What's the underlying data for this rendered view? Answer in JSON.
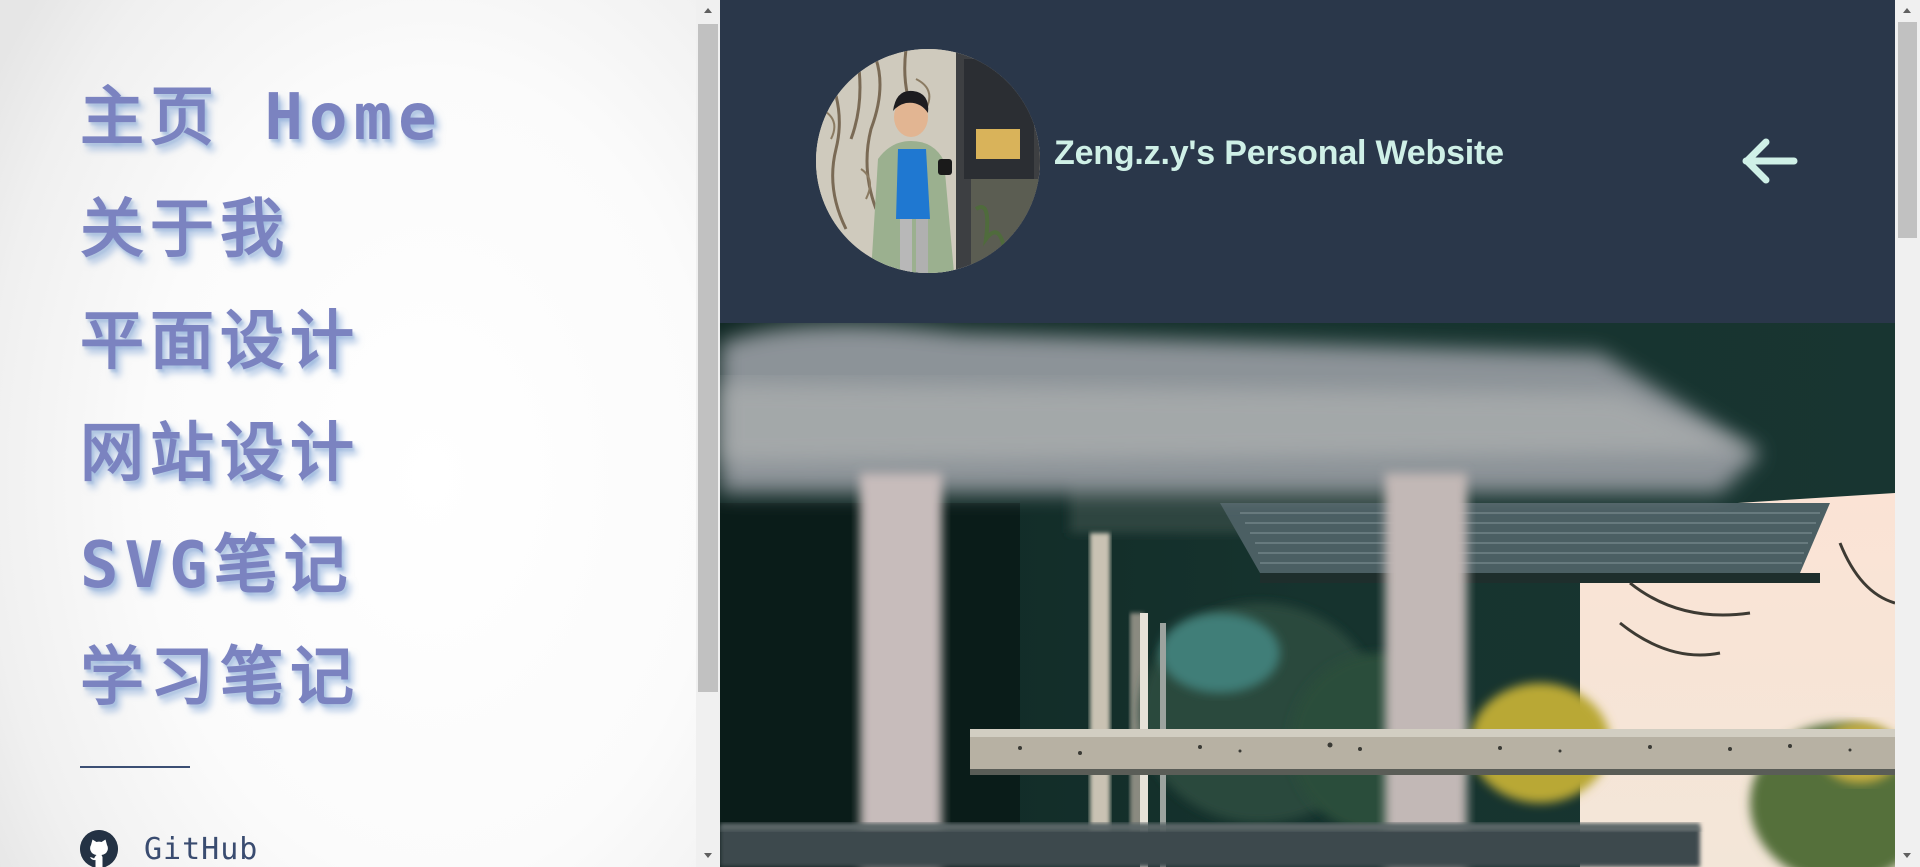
{
  "nav": {
    "items": [
      {
        "label": "主页 Home"
      },
      {
        "label": "关于我"
      },
      {
        "label": "平面设计"
      },
      {
        "label": "网站设计"
      },
      {
        "label": "SVG笔记"
      },
      {
        "label": "学习笔记"
      }
    ],
    "github_label": "GitHub",
    "github_icon": "github-icon"
  },
  "header": {
    "site_title": "Zeng.z.y's Personal Website",
    "back_icon": "arrow-left-icon",
    "avatar": "profile-photo"
  },
  "colors": {
    "nav_text": "#7b83c0",
    "nav_shadow": "#7aa0d6",
    "header_bg": "#2a374a",
    "title_text": "#cff0e7",
    "divider": "#3c4f74"
  }
}
